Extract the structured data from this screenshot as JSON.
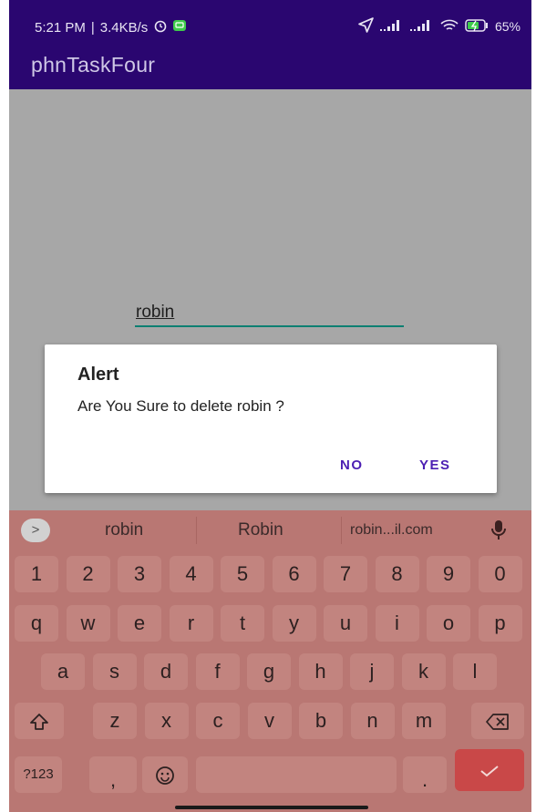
{
  "status_bar": {
    "time": "5:21 PM",
    "speed": "3.4KB/s",
    "battery": "65%",
    "icons": [
      "alarm-icon",
      "message-icon",
      "location-icon",
      "signal-icon",
      "signal-icon",
      "wifi-icon",
      "battery-icon"
    ]
  },
  "app_bar": {
    "title": "phnTaskFour"
  },
  "content": {
    "edit_text": "robin"
  },
  "dialog": {
    "title": "Alert",
    "message": "Are You Sure to delete robin ?",
    "no_label": "NO",
    "yes_label": "YES"
  },
  "keyboard": {
    "suggestions": [
      "robin",
      "Robin",
      "robin...il.com"
    ],
    "number_row": [
      "1",
      "2",
      "3",
      "4",
      "5",
      "6",
      "7",
      "8",
      "9",
      "0"
    ],
    "row1": [
      "q",
      "w",
      "e",
      "r",
      "t",
      "y",
      "u",
      "i",
      "o",
      "p"
    ],
    "row2": [
      "a",
      "s",
      "d",
      "f",
      "g",
      "h",
      "j",
      "k",
      "l"
    ],
    "row3": [
      "z",
      "x",
      "c",
      "v",
      "b",
      "n",
      "m"
    ],
    "symbols_label": "?123",
    "comma": ",",
    "period": "."
  },
  "colors": {
    "app_bar": "#2a0670",
    "accent": "#4c1fb3",
    "edit_underline": "#0d7f72",
    "keyboard_bg": "#b97773",
    "key_bg": "#c2847f",
    "enter_key": "#c94848"
  }
}
